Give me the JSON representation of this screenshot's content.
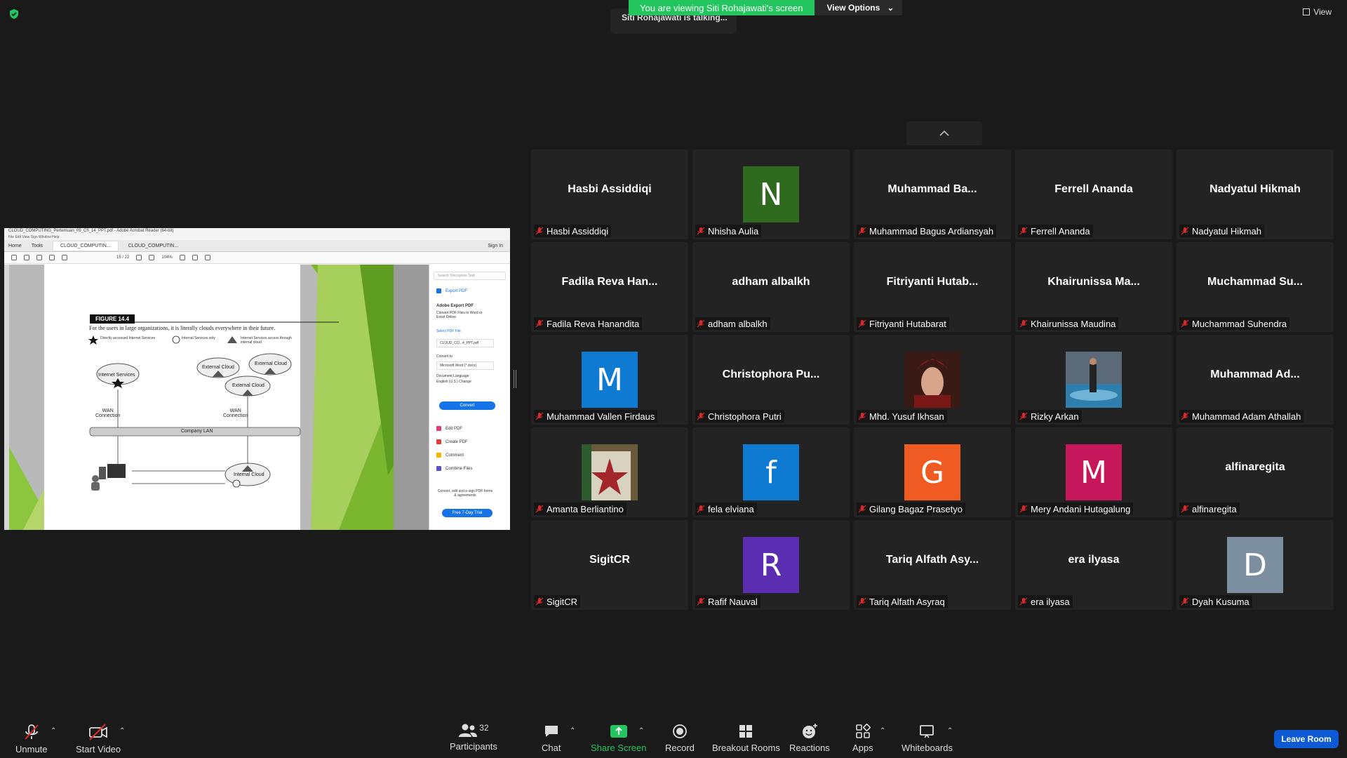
{
  "status": {
    "viewing_banner": "You are viewing Siti Rohajawati's screen",
    "view_options": "View Options",
    "talking": "Siti Rohajawati is talking...",
    "view_label": "View"
  },
  "shared_screen": {
    "window_title": "CLOUD_COMPUTING_Pertemuan_09_Ch_14_PPT.pdf - Adobe Acrobat Reader (64-bit)",
    "menu": "File   Edit   View   Sign   Window   Help",
    "tabs": [
      "Home",
      "Tools",
      "CLOUD_COMPUTIN...",
      "CLOUD_COMPUTIN..."
    ],
    "sign_in": "Sign In",
    "page_indicator": "15 / 22",
    "zoom": "104%",
    "figure": {
      "label": "FIGURE 14.4",
      "caption": "For the users in large organizations, it is literally clouds everywhere in their future.",
      "legend": [
        "Directly accessed Internet Services",
        "Internal Services only",
        "Internet Services access through internal cloud"
      ],
      "clouds": [
        "Internet Services",
        "External Cloud",
        "External Cloud",
        "External Cloud",
        "Internal Cloud"
      ],
      "wan_left": "WAN\nConnection",
      "wan_right": "WAN\nConnection",
      "lan": "Company LAN"
    },
    "right_panel": {
      "search": "Search 'Recognize Text'",
      "export_pdf": "Export PDF",
      "adobe_export": "Adobe Export PDF",
      "export_desc": "Convert PDF Files to Word or Excel Online",
      "select_file": "Select PDF File",
      "file_name": "CLOUD_CO...4_PPT.pdf",
      "convert_to": "Convert to",
      "convert_format": "Microsoft Word (*.docx)",
      "doc_lang": "Document Language:",
      "lang_value": "English (U.S.) Change",
      "convert_btn": "Convert",
      "tools": [
        "Edit PDF",
        "Create PDF",
        "Comment",
        "Combine Files"
      ],
      "promo": "Convert, edit and e-sign PDF forms & agreements",
      "trial_btn": "Free 7-Day Trial"
    }
  },
  "participants_tiles": [
    {
      "big": "Hasbi Assiddiqi",
      "name": "Hasbi Assiddiqi"
    },
    {
      "avatar": "N",
      "color": "#2e6b1f",
      "name": "Nhisha Aulia"
    },
    {
      "big": "Muhammad  Ba...",
      "name": "Muhammad Bagus Ardiansyah"
    },
    {
      "big": "Ferrell Ananda",
      "name": "Ferrell Ananda"
    },
    {
      "big": "Nadyatul Hikmah",
      "name": "Nadyatul Hikmah"
    },
    {
      "big": "Fadila Reva Han...",
      "name": "Fadila Reva Hanandita"
    },
    {
      "big": "adham albalkh",
      "name": "adham albalkh"
    },
    {
      "big": "Fitriyanti  Hutab...",
      "name": "Fitriyanti Hutabarat"
    },
    {
      "big": "Khairunissa  Ma...",
      "name": "Khairunissa Maudina"
    },
    {
      "big": "Muchammad  Su...",
      "name": "Muchammad Suhendra"
    },
    {
      "avatar": "M",
      "color": "#0e7ad1",
      "name": "Muhammad Vallen Firdaus"
    },
    {
      "big": "Christophora  Pu...",
      "name": "Christophora Putri"
    },
    {
      "photo": "portrait-red",
      "name": "Mhd. Yusuf Ikhsan"
    },
    {
      "photo": "portrait-pool",
      "name": "Rizky Arkan"
    },
    {
      "big": "Muhammad  Ad...",
      "name": "Muhammad Adam Athallah"
    },
    {
      "photo": "portrait-costume",
      "name": "Amanta Berliantino"
    },
    {
      "avatar": "f",
      "color": "#0e7ad1",
      "name": "fela elviana"
    },
    {
      "avatar": "G",
      "color": "#f05a23",
      "name": "Gilang Bagaz Prasetyo"
    },
    {
      "avatar": "M",
      "color": "#c6175a",
      "name": "Mery Andani Hutagalung"
    },
    {
      "big": "alfinaregita",
      "name": "alfinaregita"
    },
    {
      "big": "SigitCR",
      "name": "SigitCR"
    },
    {
      "avatar": "R",
      "color": "#5b2db0",
      "name": "Rafif Nauval"
    },
    {
      "big": "Tariq Alfath Asy...",
      "name": "Tariq Alfath Asyraq"
    },
    {
      "big": "era ilyasa",
      "name": "era ilyasa"
    },
    {
      "avatar": "D",
      "color": "#7b8fa0",
      "name": "Dyah Kusuma"
    }
  ],
  "footer": {
    "unmute": "Unmute",
    "start_video": "Start Video",
    "participants": "Participants",
    "participants_count": "32",
    "chat": "Chat",
    "share_screen": "Share Screen",
    "record": "Record",
    "breakout": "Breakout Rooms",
    "reactions": "Reactions",
    "apps": "Apps",
    "whiteboards": "Whiteboards",
    "leave": "Leave Room"
  }
}
